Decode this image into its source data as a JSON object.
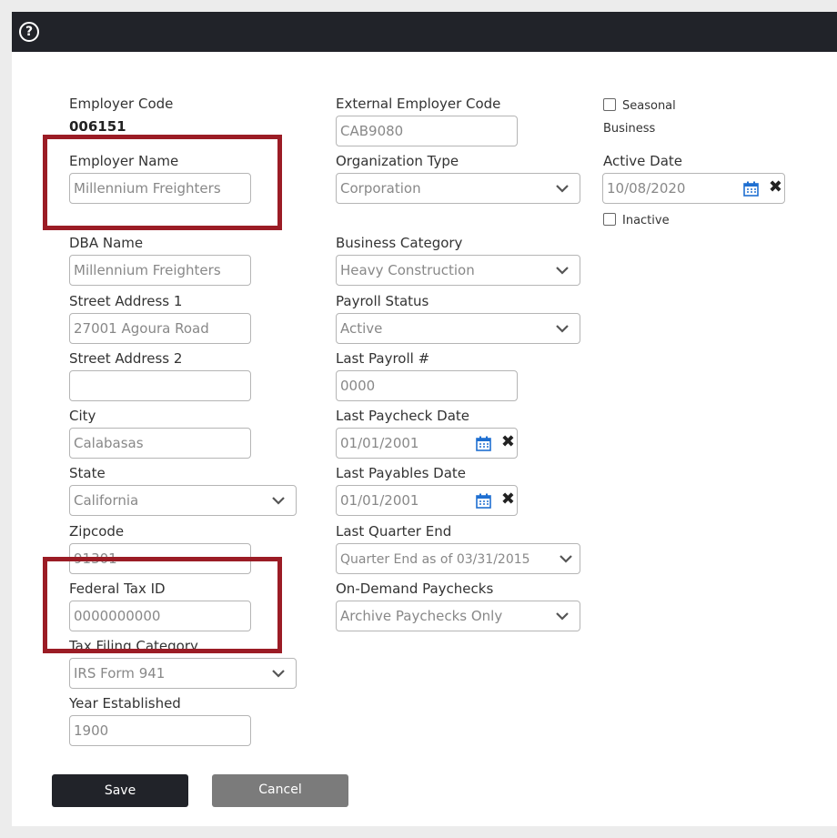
{
  "header": {
    "help_icon": "question-circle-icon"
  },
  "col1": {
    "employer_code_label": "Employer Code",
    "employer_code_value": "006151",
    "employer_name_label": "Employer Name",
    "employer_name_value": "Millennium Freighters",
    "dba_label": "DBA Name",
    "dba_value": "Millennium Freighters",
    "street1_label": "Street Address 1",
    "street1_value": "27001 Agoura Road",
    "street2_label": "Street Address 2",
    "street2_value": "",
    "city_label": "City",
    "city_value": "Calabasas",
    "state_label": "State",
    "state_value": "California",
    "zip_label": "Zipcode",
    "zip_value": "91301",
    "fein_label": "Federal Tax ID",
    "fein_value": "0000000000",
    "tax_filing_label": "Tax Filing Category",
    "tax_filing_value": "IRS Form 941",
    "year_label": "Year Established",
    "year_value": "1900"
  },
  "col2": {
    "ext_code_label": "External Employer Code",
    "ext_code_value": "CAB9080",
    "org_type_label": "Organization Type",
    "org_type_value": "Corporation",
    "biz_cat_label": "Business Category",
    "biz_cat_value": "Heavy Construction",
    "payroll_status_label": "Payroll Status",
    "payroll_status_value": "Active",
    "last_payroll_label": "Last Payroll #",
    "last_payroll_value": "0000",
    "last_paycheck_label": "Last Paycheck Date",
    "last_paycheck_value": "01/01/2001",
    "last_payables_label": "Last Payables Date",
    "last_payables_value": "01/01/2001",
    "last_quarter_label": "Last Quarter End",
    "last_quarter_value": "Quarter End as of 03/31/2015",
    "on_demand_label": "On-Demand Paychecks",
    "on_demand_value": "Archive Paychecks Only"
  },
  "col3": {
    "seasonal_label_1": "Seasonal",
    "seasonal_label_2": "Business",
    "active_date_label": "Active Date",
    "active_date_value": "10/08/2020",
    "inactive_label": "Inactive"
  },
  "buttons": {
    "save": "Save",
    "cancel": "Cancel"
  },
  "colors": {
    "topbar": "#212329",
    "highlight": "#9b1c25",
    "calendar": "#1f6fd1"
  }
}
